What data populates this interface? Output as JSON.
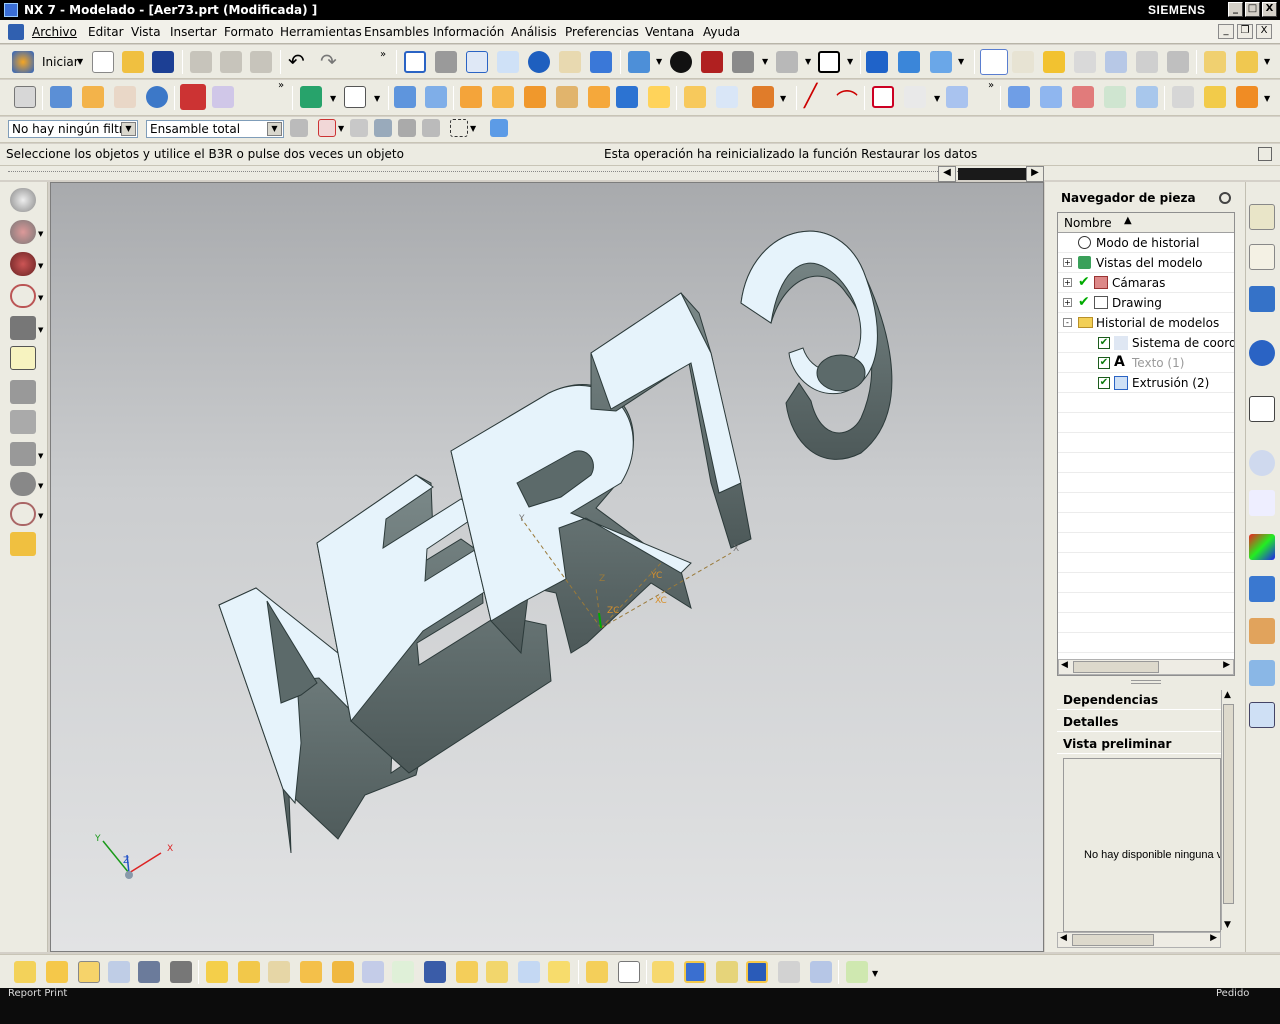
{
  "window": {
    "title": "NX 7 - Modelado - [Aer73.prt (Modificada) ]",
    "brand": "SIEMENS",
    "controls": [
      "_",
      "□",
      "X"
    ]
  },
  "menu": {
    "items": [
      "Archivo",
      "Editar",
      "Vista",
      "Insertar",
      "Formato",
      "Herramientas",
      "Ensambles",
      "Información",
      "Análisis",
      "Preferencias",
      "Ventana",
      "Ayuda"
    ],
    "mdi_controls": [
      "_",
      "❐",
      "X"
    ]
  },
  "toolbar": {
    "start_label": "Iniciar",
    "filter_select": "No hay ningún filtro",
    "assembly_select": "Ensamble total"
  },
  "status": {
    "left": "Seleccione los objetos y utilice el B3R o pulse dos veces un objeto",
    "right": "Esta operación ha reinicializado la función Restaurar los datos"
  },
  "graphics": {
    "model_text": "AER73",
    "wcs_labels": {
      "x": "X",
      "y": "Y",
      "z": "Z",
      "xc": "XC",
      "yc": "YC",
      "zc": "ZC"
    }
  },
  "navigator": {
    "title": "Navegador de pieza",
    "column_header": "Nombre",
    "rows": [
      {
        "label": "Modo de historial",
        "level": 0,
        "expander": "",
        "check": false,
        "icon": "clock-icon",
        "dimmed": false
      },
      {
        "label": "Vistas del modelo",
        "level": 0,
        "expander": "+",
        "check": false,
        "icon": "cube-views-icon",
        "dimmed": false
      },
      {
        "label": "Cámaras",
        "level": 0,
        "expander": "+",
        "check": true,
        "icon": "camera-icon",
        "dimmed": false
      },
      {
        "label": "Drawing",
        "level": 0,
        "expander": "+",
        "check": true,
        "icon": "drawing-icon",
        "dimmed": false
      },
      {
        "label": "Historial de modelos",
        "level": 0,
        "expander": "-",
        "check": false,
        "icon": "folder-icon",
        "dimmed": false
      },
      {
        "label": "Sistema de coordenadas",
        "level": 1,
        "expander": "",
        "check": true,
        "icon": "csys-icon",
        "dimmed": false
      },
      {
        "label": "Texto (1)",
        "level": 1,
        "expander": "",
        "check": true,
        "icon": "text-icon",
        "dimmed": true
      },
      {
        "label": "Extrusión (2)",
        "level": 1,
        "expander": "",
        "check": true,
        "icon": "extrude-icon",
        "dimmed": false
      }
    ],
    "sections": [
      "Dependencias",
      "Detalles",
      "Vista preliminar"
    ],
    "preview_message": "No hay disponible ninguna vista preliminar"
  },
  "taskbar": {
    "left": "Report Print",
    "right": "Pedido"
  },
  "colors": {
    "letter_face": "#e6f3fb",
    "letter_side": "#6b7a7a",
    "letter_edge": "#2c3a3a",
    "title_bar": "#000000",
    "wcs": "#9a7a3a"
  }
}
